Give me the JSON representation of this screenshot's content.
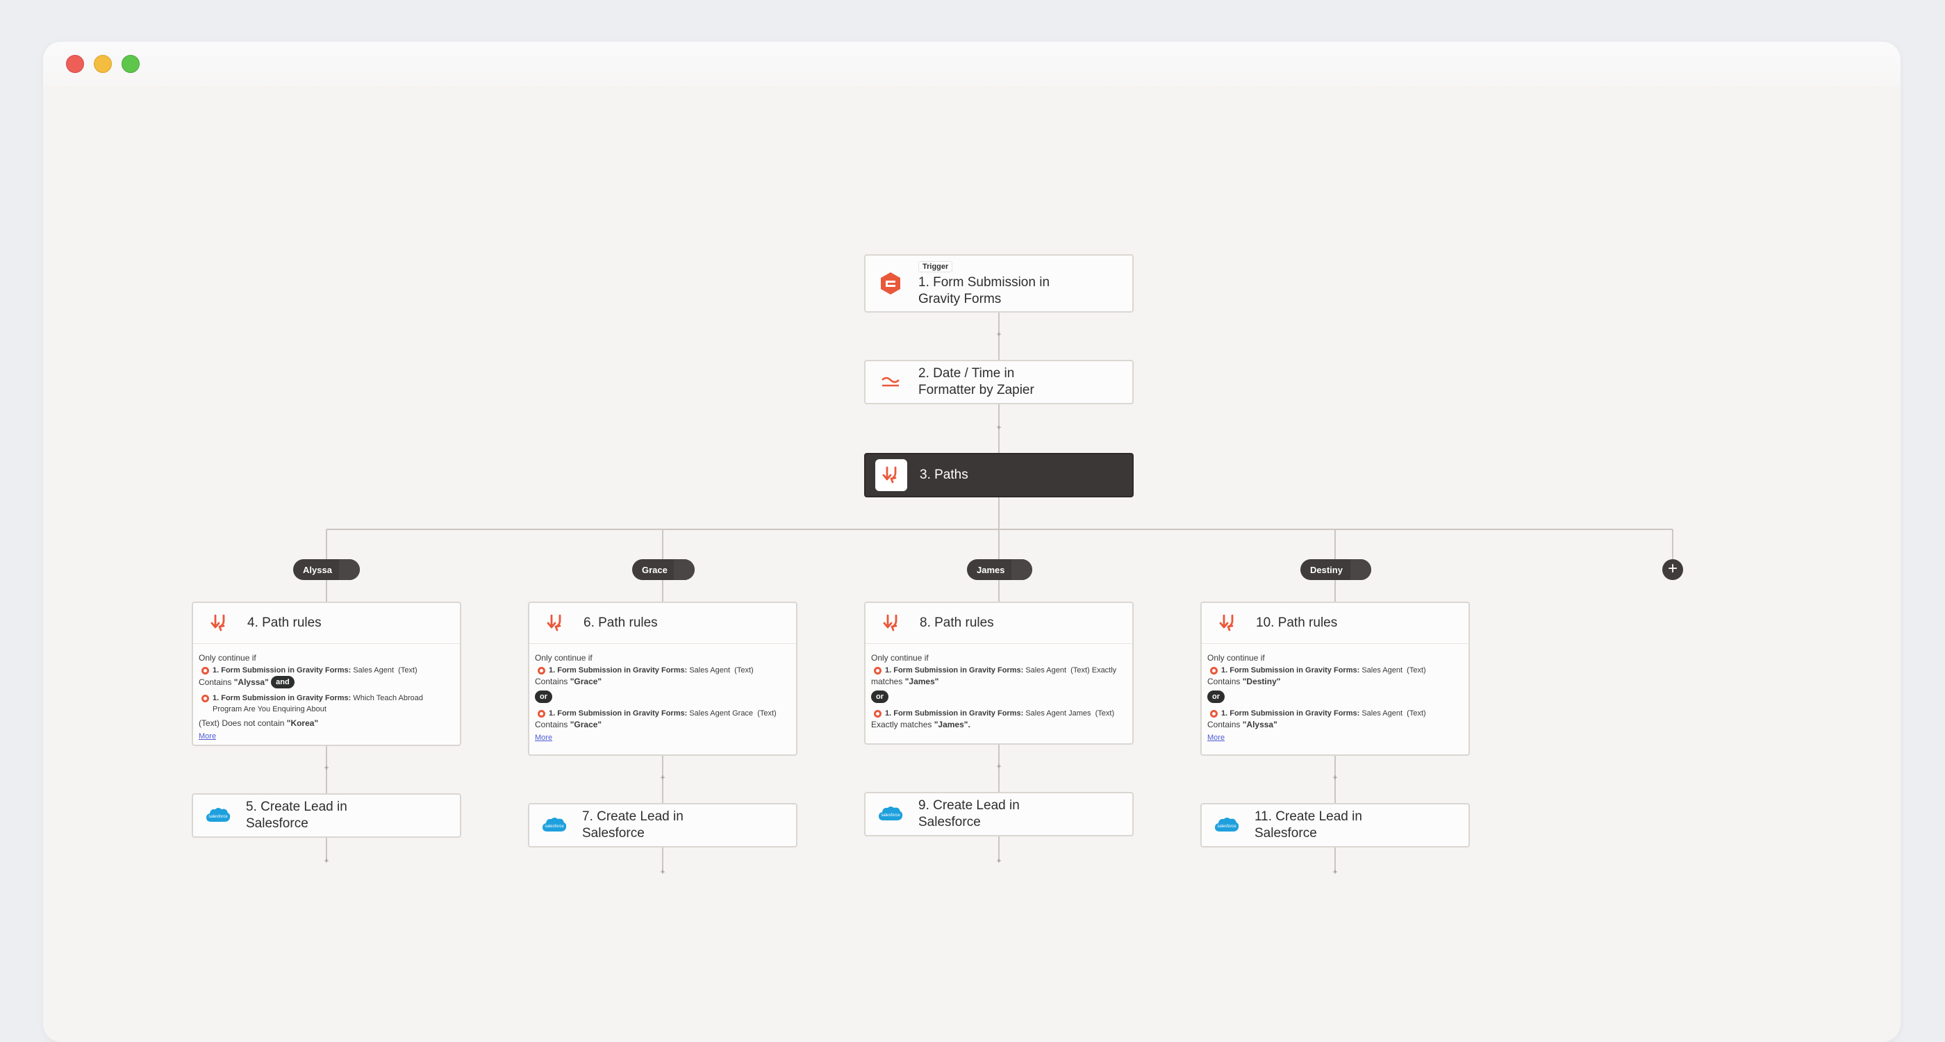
{
  "window": {
    "controls": [
      "close",
      "minimize",
      "zoom"
    ]
  },
  "trigger": {
    "badge": "Trigger",
    "title_line1": "1. Form Submission in",
    "title_line2": "Gravity Forms",
    "icon": "gravity-forms-icon"
  },
  "formatter": {
    "title_line1": "2. Date / Time in",
    "title_line2": "Formatter by Zapier",
    "icon": "formatter-icon"
  },
  "paths": {
    "title": "3. Paths",
    "icon": "paths-icon"
  },
  "branches": [
    {
      "pill": "Alyssa",
      "rule_title": "4. Path rules",
      "only": "Only continue if",
      "cond1_src": "1. Form Submission in Gravity Forms:",
      "cond1_field": "Sales Agent",
      "cond1_type": "(Text)",
      "cond1_op": "Contains",
      "cond1_val": "\"Alyssa\"",
      "joiner": "and",
      "cond2_src": "1. Form Submission in Gravity Forms:",
      "cond2_field": "Which Teach Abroad",
      "cond2_field2": "Program Are You Enquiring About",
      "cond2_type": "(Text)",
      "cond2_op": "Does not contain",
      "cond2_val": "\"Korea\"",
      "more": "More",
      "action_line1": "5. Create Lead in",
      "action_line2": "Salesforce"
    },
    {
      "pill": "Grace",
      "rule_title": "6. Path rules",
      "only": "Only continue if",
      "cond1_src": "1. Form Submission in Gravity Forms:",
      "cond1_field": "Sales Agent",
      "cond1_type": "(Text)",
      "cond1_op": "Contains",
      "cond1_val": "\"Grace\"",
      "joiner": "or",
      "cond2_src": "1. Form Submission in Gravity Forms:",
      "cond2_field": "Sales Agent Grace",
      "cond2_type": "(Text)",
      "cond2_op": "Contains",
      "cond2_val": "\"Grace\"",
      "more": "More",
      "action_line1": "7. Create Lead in",
      "action_line2": "Salesforce"
    },
    {
      "pill": "James",
      "rule_title": "8. Path rules",
      "only": "Only continue if",
      "cond1_src": "1. Form Submission in Gravity Forms:",
      "cond1_field": "Sales Agent",
      "cond1_type": "(Text) Exactly",
      "cond1_op": "matches",
      "cond1_val": "\"James\"",
      "joiner": "or",
      "cond2_src": "1. Form Submission in Gravity Forms:",
      "cond2_field": "Sales Agent James",
      "cond2_type": "(Text)",
      "cond2_op": "Exactly matches",
      "cond2_val": "\"James\".",
      "action_line1": "9. Create Lead in",
      "action_line2": "Salesforce"
    },
    {
      "pill": "Destiny",
      "rule_title": "10. Path rules",
      "only": "Only continue if",
      "cond1_src": "1. Form Submission in Gravity Forms:",
      "cond1_field": "Sales Agent",
      "cond1_type": "(Text)",
      "cond1_op": "Contains",
      "cond1_val": "\"Destiny\"",
      "joiner": "or",
      "cond2_src": "1. Form Submission in Gravity Forms:",
      "cond2_field": "Sales Agent",
      "cond2_type": "(Text)",
      "cond2_op": "Contains",
      "cond2_val": "\"Alyssa\"",
      "more": "More",
      "action_line1": "11. Create Lead in",
      "action_line2": "Salesforce"
    }
  ],
  "add_path_glyph": "+",
  "connector_plus": "+",
  "salesforce_label": "salesforce",
  "colors": {
    "canvas": "#f6f4f2",
    "accent_orange": "#e9583a",
    "dark_node": "#3b3736",
    "salesforce_blue": "#1ea0dd",
    "link": "#4b5bd6"
  }
}
